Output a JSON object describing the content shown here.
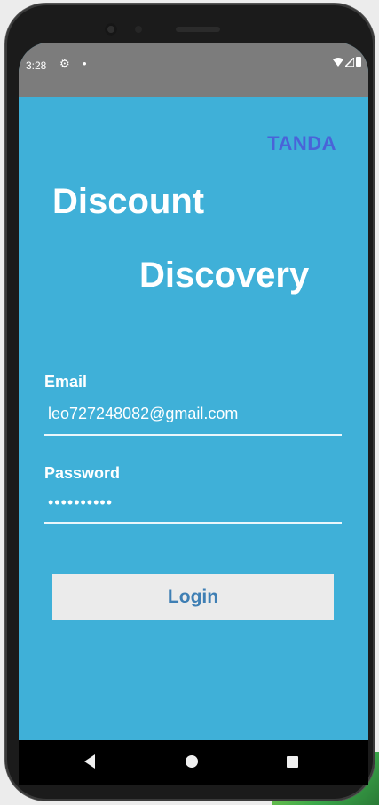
{
  "status_bar": {
    "time": "3:28",
    "gear_icon": "⚙",
    "notification_dot": "•",
    "icons": [
      "wifi-icon",
      "signal-icon",
      "battery-icon"
    ]
  },
  "app": {
    "brand": "TANDA",
    "title_line_1": "Discount",
    "title_line_2": "Discovery"
  },
  "form": {
    "email_label": "Email",
    "email_value": "leo727248082@gmail.com",
    "password_label": "Password",
    "password_value": "••••••••••",
    "login_label": "Login"
  },
  "nav_bar": {
    "buttons": [
      "back",
      "home",
      "recents"
    ]
  },
  "colors": {
    "background": "#3fb0d8",
    "brand": "#4a63d8",
    "button_bg": "#ebebeb",
    "button_text": "#3f7fb4"
  }
}
